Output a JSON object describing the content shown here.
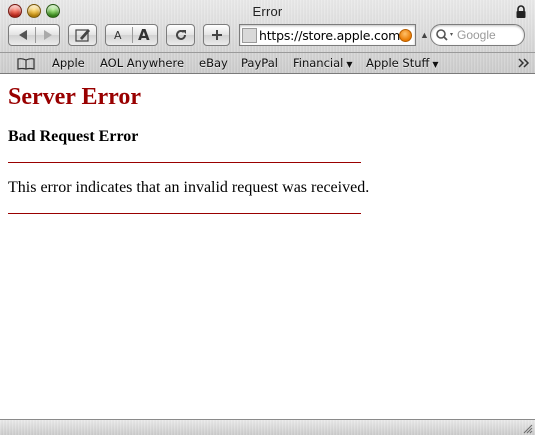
{
  "window": {
    "title": "Error"
  },
  "toolbar": {
    "text_smaller_label": "A",
    "text_bigger_label": "A",
    "address_value": "https://store.apple.com",
    "search_placeholder": "Google"
  },
  "bookmarks": {
    "items": [
      {
        "label": "Apple",
        "has_menu": false
      },
      {
        "label": "AOL Anywhere",
        "has_menu": false
      },
      {
        "label": "eBay",
        "has_menu": false
      },
      {
        "label": "PayPal",
        "has_menu": false
      },
      {
        "label": "Financial",
        "has_menu": true
      },
      {
        "label": "Apple Stuff",
        "has_menu": true
      }
    ]
  },
  "page": {
    "title": "Server Error",
    "subtitle": "Bad Request Error",
    "message": "This error indicates that an invalid request was received."
  },
  "colors": {
    "title_red": "#990000",
    "rule_red": "#990000",
    "snapback_orange": "#e97a00"
  },
  "icons": {
    "close": "close-button",
    "minimize": "minimize-button",
    "zoom": "zoom-button",
    "lock": "lock-icon",
    "back": "back-arrow-icon",
    "forward": "forward-arrow-icon",
    "bug": "report-bug-icon",
    "reload": "reload-icon",
    "add_bookmark": "plus-icon",
    "bookmarks": "open-book-icon",
    "search": "magnifier-icon",
    "overflow": "double-chevron-icon"
  }
}
